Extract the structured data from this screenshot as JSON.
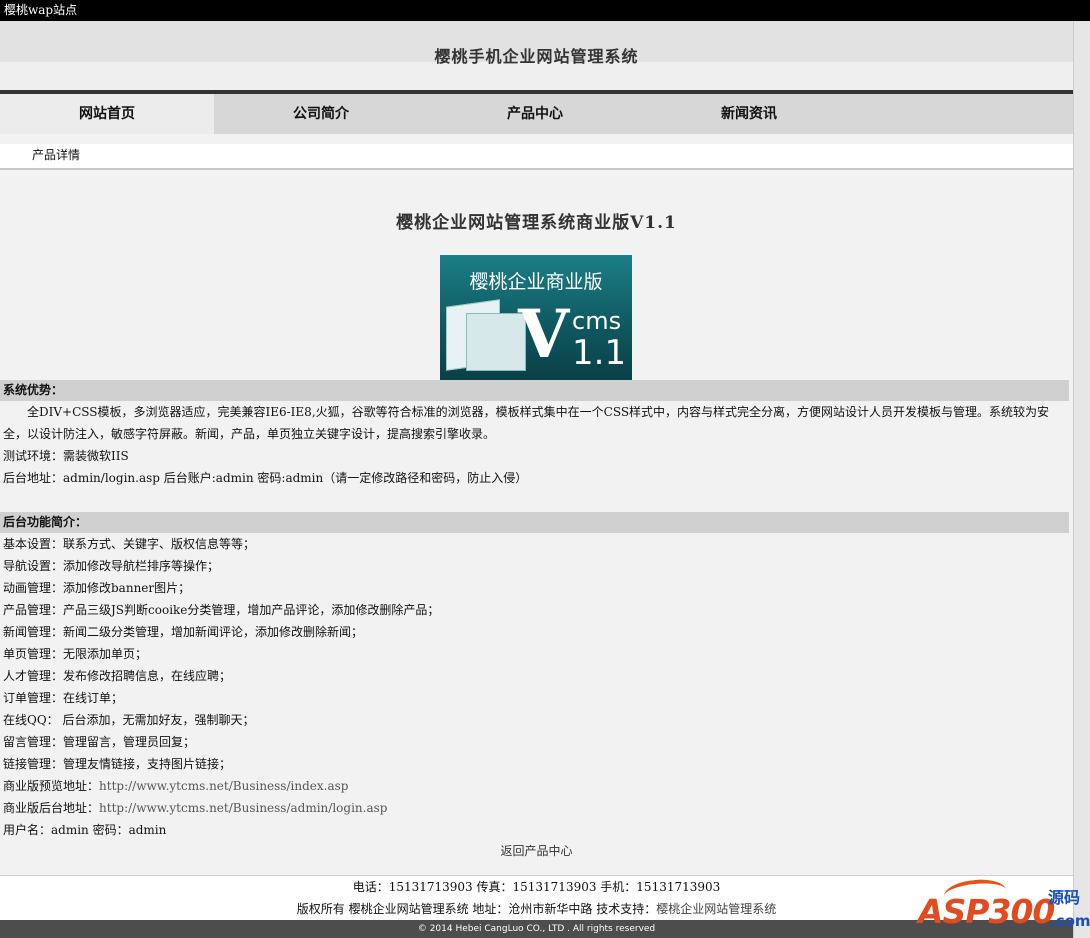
{
  "window": {
    "title": "樱桃wap站点"
  },
  "header": {
    "site_title": "樱桃手机企业网站管理系统"
  },
  "nav": {
    "items": [
      {
        "label": "网站首页"
      },
      {
        "label": "公司简介"
      },
      {
        "label": "产品中心"
      },
      {
        "label": "新闻资讯"
      }
    ]
  },
  "breadcrumb": {
    "label": "产品详情"
  },
  "product": {
    "title": "樱桃企业网站管理系统商业版V1.1",
    "image": {
      "headline": "樱桃企业商业版",
      "letter": "V",
      "cms": "cms",
      "version": "1.1"
    }
  },
  "advantages": {
    "heading": "系统优势：",
    "paragraph": "　　全DIV+CSS模板，多浏览器适应，完美兼容IE6-IE8,火狐，谷歌等符合标准的浏览器，模板样式集中在一个CSS样式中，内容与样式完全分离，方便网站设计人员开发模板与管理。系统较为安全，以设计防注入，敏感字符屏蔽。新闻，产品，单页独立关键字设计，提高搜索引擎收录。",
    "env": "测试环境：需装微软IIS",
    "admin": "后台地址：admin/login.asp 后台账户:admin 密码:admin（请一定修改路径和密码，防止入侵）"
  },
  "features": {
    "heading": "后台功能简介：",
    "items": [
      "基本设置：联系方式、关键字、版权信息等等；",
      "导航设置：添加修改导航栏排序等操作；",
      "动画管理：添加修改banner图片；",
      "产品管理：产品三级JS判断cooike分类管理，增加产品评论，添加修改删除产品；",
      "新闻管理：新闻二级分类管理，增加新闻评论，添加修改删除新闻；",
      "单页管理：无限添加单页；",
      "人才管理：发布修改招聘信息，在线应聘；",
      "订单管理：在线订单；",
      "在线QQ： 后台添加，无需加好友，强制聊天；",
      "留言管理：管理留言，管理员回复；",
      "链接管理：管理友情链接，支持图片链接；"
    ],
    "preview_label": "商业版预览地址：",
    "preview_url": "http://www.ytcms.net/Business/index.asp",
    "admin_label": "商业版后台地址：",
    "admin_url": "http://www.ytcms.net/Business/admin/login.asp",
    "credentials": "用户名：admin 密码：admin"
  },
  "back_link": "返回产品中心",
  "footer": {
    "contact": "电话：15131713903 传真：15131713903 手机：15131713903",
    "copyright_prefix": "版权所有 樱桃企业网站管理系统 地址：沧州市新华中路 技术支持：",
    "support": "樱桃企业网站管理系统",
    "bottom": "© 2014 Hebei CangLuo CO., LTD . All rights reserved"
  },
  "watermark": {
    "brand": "ASP300",
    "suffix": "源码",
    "domain": ".com"
  }
}
